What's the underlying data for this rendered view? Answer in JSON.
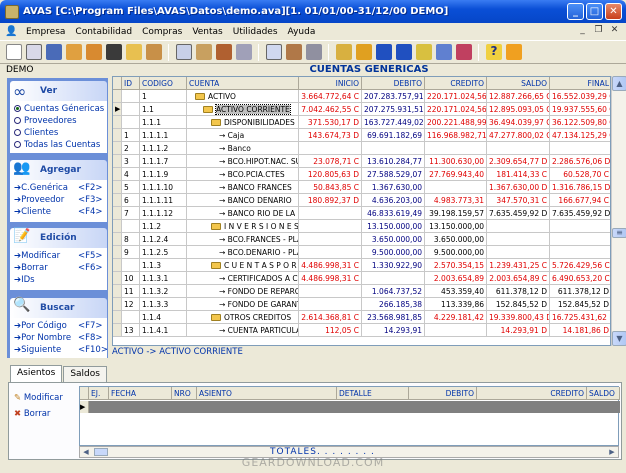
{
  "window": {
    "title": "AVAS [C:\\Program Files\\AVAS\\Datos\\demo.ava][1. 01/01/00-31/12/00    DEMO]"
  },
  "menu": [
    "Empresa",
    "Contabilidad",
    "Compras",
    "Ventas",
    "Utilidades",
    "Ayuda"
  ],
  "company": "DEMO",
  "grid_title": "CUENTAS GENERICAS",
  "sidebar": {
    "ver": {
      "title": "Ver",
      "items": [
        "Cuentas Génericas",
        "Proveedores",
        "Clientes",
        "Todas las Cuentas"
      ]
    },
    "agregar": {
      "title": "Agregar",
      "items": [
        {
          "label": "C.Genérica",
          "key": "<F2>"
        },
        {
          "label": "Proveedor",
          "key": "<F3>"
        },
        {
          "label": "Cliente",
          "key": "<F4>"
        }
      ]
    },
    "edicion": {
      "title": "Edición",
      "items": [
        {
          "label": "Modificar",
          "key": "<F5>"
        },
        {
          "label": "Borrar",
          "key": "<F6>"
        },
        {
          "label": "IDs",
          "key": ""
        }
      ]
    },
    "buscar": {
      "title": "Buscar",
      "items": [
        {
          "label": "Por Código",
          "key": "<F7>"
        },
        {
          "label": "Por Nombre",
          "key": "<F8>"
        },
        {
          "label": "Siguiente",
          "key": "<F10>"
        }
      ]
    }
  },
  "columns": [
    "ID",
    "CODIGO",
    "CUENTA",
    "INICIO",
    "DEBITO",
    "CREDITO",
    "SALDO",
    "FINAL"
  ],
  "rows": [
    {
      "id": "",
      "codigo": "1",
      "cuenta": "ACTIVO",
      "folder": true,
      "indent": 1,
      "inicio": "3.664.772,64 C",
      "debito": "207.283.757,91",
      "credito": "220.171.024,56",
      "saldo": "12.887.266,65 C",
      "final": "16.552.039,29 C",
      "red": true
    },
    {
      "id": "",
      "codigo": "1.1",
      "cuenta": "ACTIVO CORRIENTE",
      "folder": true,
      "indent": 2,
      "inicio": "7.042.462,55 C",
      "debito": "207.275.931,51",
      "credito": "220.171.024,56",
      "saldo": "12.895.093,05 C",
      "final": "19.937.555,60 C",
      "red": true,
      "selected": true
    },
    {
      "id": "",
      "codigo": "1.1.1",
      "cuenta": "DISPONIBILIDADES",
      "folder": true,
      "indent": 3,
      "inicio": "371.530,17 D",
      "debito": "163.727.449,02",
      "credito": "200.221.488,99",
      "saldo": "36.494.039,97 C",
      "final": "36.122.509,80 C",
      "red": true
    },
    {
      "id": "1",
      "codigo": "1.1.1.1",
      "cuenta": "→ Caja",
      "folder": false,
      "indent": 4,
      "inicio": "143.674,73 D",
      "debito": "69.691.182,69",
      "credito": "116.968.982,71",
      "saldo": "47.277.800,02 C",
      "final": "47.134.125,29 C",
      "red": true
    },
    {
      "id": "2",
      "codigo": "1.1.1.2",
      "cuenta": "→ Banco",
      "folder": false,
      "indent": 4,
      "inicio": "",
      "debito": "",
      "credito": "",
      "saldo": "",
      "final": "",
      "red": false
    },
    {
      "id": "3",
      "codigo": "1.1.1.7",
      "cuenta": "→ BCO.HIPOT.NAC. SUC.",
      "folder": false,
      "indent": 4,
      "inicio": "23.078,71 C",
      "debito": "13.610.284,77",
      "credito": "11.300.630,00",
      "saldo": "2.309.654,77 D",
      "final": "2.286.576,06 D",
      "red": true
    },
    {
      "id": "4",
      "codigo": "1.1.1.9",
      "cuenta": "→ BCO.PCIA.CTES",
      "folder": false,
      "indent": 4,
      "inicio": "120.805,63 D",
      "debito": "27.588.529,07",
      "credito": "27.769.943,40",
      "saldo": "181.414,33 C",
      "final": "60.528,70 C",
      "red": true
    },
    {
      "id": "5",
      "codigo": "1.1.1.10",
      "cuenta": "→ BANCO FRANCES",
      "folder": false,
      "indent": 4,
      "inicio": "50.843,85 C",
      "debito": "1.367.630,00",
      "credito": "",
      "saldo": "1.367.630,00 D",
      "final": "1.316.786,15 D",
      "red": true
    },
    {
      "id": "6",
      "codigo": "1.1.1.11",
      "cuenta": "→ BANCO DENARIO",
      "folder": false,
      "indent": 4,
      "inicio": "180.892,37 D",
      "debito": "4.636.203,00",
      "credito": "4.983.773,31",
      "saldo": "347.570,31 C",
      "final": "166.677,94 C",
      "red": true
    },
    {
      "id": "7",
      "codigo": "1.1.1.12",
      "cuenta": "→ BANCO RIO DE LA PLA",
      "folder": false,
      "indent": 4,
      "inicio": "",
      "debito": "46.833.619,49",
      "credito": "39.198.159,57",
      "saldo": "7.635.459,92 D",
      "final": "7.635.459,92 D",
      "red": false
    },
    {
      "id": "",
      "codigo": "1.1.2",
      "cuenta": "I N V E R S I O N E S",
      "folder": true,
      "indent": 3,
      "inicio": "",
      "debito": "13.150.000,00",
      "credito": "13.150.000,00",
      "saldo": "",
      "final": "",
      "red": false
    },
    {
      "id": "8",
      "codigo": "1.1.2.4",
      "cuenta": "→ BCO.FRANCES - PLAZ",
      "folder": false,
      "indent": 4,
      "inicio": "",
      "debito": "3.650.000,00",
      "credito": "3.650.000,00",
      "saldo": "",
      "final": "",
      "red": false
    },
    {
      "id": "9",
      "codigo": "1.1.2.5",
      "cuenta": "→ BCO.DENARIO - PLAZ",
      "folder": false,
      "indent": 4,
      "inicio": "",
      "debito": "9.500.000,00",
      "credito": "9.500.000,00",
      "saldo": "",
      "final": "",
      "red": false
    },
    {
      "id": "",
      "codigo": "1.1.3",
      "cuenta": "C U E N T A S  P O R  C O B R",
      "folder": true,
      "indent": 3,
      "inicio": "4.486.998,31 C",
      "debito": "1.330.922,90",
      "credito": "2.570.354,15",
      "saldo": "1.239.431,25 C",
      "final": "5.726.429,56 C",
      "red": true
    },
    {
      "id": "10",
      "codigo": "1.1.3.1",
      "cuenta": "→ CERTIFICADOS A COB",
      "folder": false,
      "indent": 4,
      "inicio": "4.486.998,31 C",
      "debito": "",
      "credito": "2.003.654,89",
      "saldo": "2.003.654,89 C",
      "final": "6.490.653,20 C",
      "red": true
    },
    {
      "id": "11",
      "codigo": "1.1.3.2",
      "cuenta": "→ FONDO DE REPARO A",
      "folder": false,
      "indent": 4,
      "inicio": "",
      "debito": "1.064.737,52",
      "credito": "453.359,40",
      "saldo": "611.378,12 D",
      "final": "611.378,12 D",
      "red": false
    },
    {
      "id": "12",
      "codigo": "1.1.3.3",
      "cuenta": "→ FONDO DE GARANTIA",
      "folder": false,
      "indent": 4,
      "inicio": "",
      "debito": "266.185,38",
      "credito": "113.339,86",
      "saldo": "152.845,52 D",
      "final": "152.845,52 D",
      "red": false
    },
    {
      "id": "",
      "codigo": "1.1.4",
      "cuenta": "OTROS CREDITOS",
      "folder": true,
      "indent": 3,
      "inicio": "2.614.368,81 C",
      "debito": "23.568.981,85",
      "credito": "4.229.181,42",
      "saldo": "19.339.800,43 D",
      "final": "16.725.431,62 D",
      "red": true
    },
    {
      "id": "13",
      "codigo": "1.1.4.1",
      "cuenta": "→ CUENTA PARTICULAR",
      "folder": false,
      "indent": 4,
      "inicio": "112,05 C",
      "debito": "14.293,91",
      "credito": "",
      "saldo": "14.293,91 D",
      "final": "14.181,86 D",
      "red": true
    }
  ],
  "status_path": "ACTIVO -> ACTIVO CORRIENTE",
  "tabs": [
    "Asientos",
    "Saldos"
  ],
  "asientos": {
    "buttons": [
      "Modificar",
      "Borrar"
    ],
    "columns": [
      "EJ.",
      "FECHA",
      "NRO",
      "ASIENTO",
      "DETALLE",
      "DEBITO",
      "CREDITO",
      "SALDO"
    ]
  },
  "totales": "TOTALES. . . . . . . .",
  "watermark": "GEARDOWNLOAD.COM"
}
